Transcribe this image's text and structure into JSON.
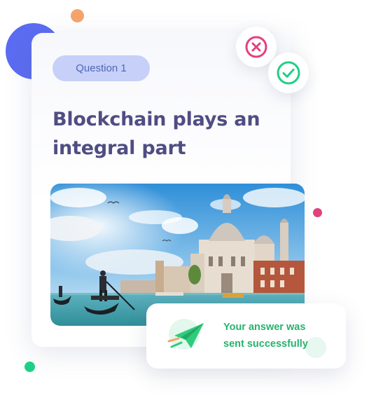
{
  "question": {
    "badge": "Question 1",
    "title": "Blockchain plays an integral part"
  },
  "actions": {
    "reject_icon": "close-circle-icon",
    "accept_icon": "check-circle-icon",
    "reject_color": "#e2417f",
    "accept_color": "#1fcf86"
  },
  "image": {
    "subject": "venice-canal-photo"
  },
  "notification": {
    "message": "Your answer was sent successfully",
    "icon": "paper-plane-icon",
    "color": "#27b36d"
  },
  "decorations": {
    "colors": [
      "#f5a46e",
      "#5b6cf2",
      "#e2417f",
      "#1fcf86"
    ]
  }
}
